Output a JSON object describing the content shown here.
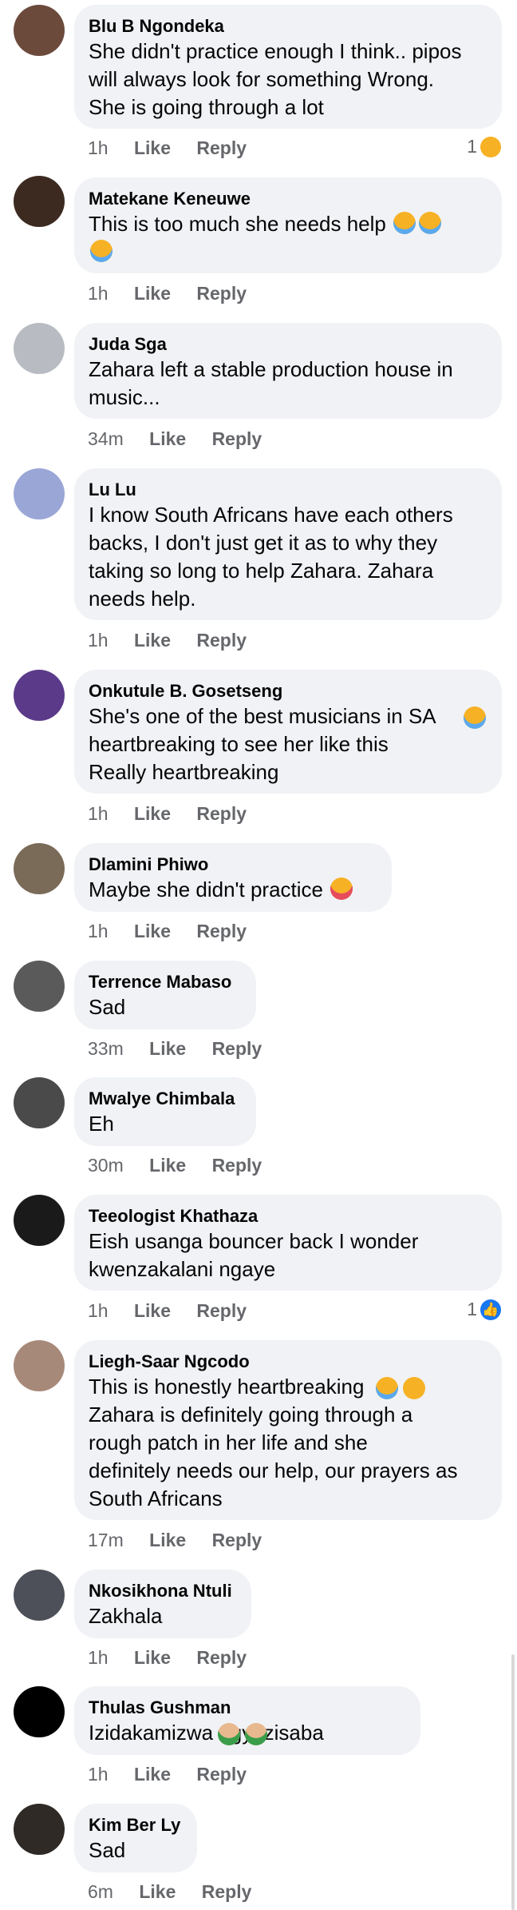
{
  "comments": [
    {
      "author": "Blu B Ngondeka",
      "text": "She didn't practice enough I think.. pipos\nwill always look for something Wrong.\nShe is going through a lot",
      "time": "1h",
      "like": "Like",
      "reply": "Reply",
      "reactions": "1",
      "reaction_icon": "sad",
      "avatar_color": "#6b4a3c"
    },
    {
      "author": "Matekane Keneuwe",
      "text": "This is too much she needs help",
      "time": "1h",
      "like": "Like",
      "reply": "Reply",
      "avatar_color": "#3c2a20"
    },
    {
      "author": "Juda Sga",
      "text": "Zahara left a stable production house in\nmusic...",
      "time": "34m",
      "like": "Like",
      "reply": "Reply",
      "avatar_color": "#b8bcc2"
    },
    {
      "author": "Lu Lu",
      "text": "I know South Africans have each others\nbacks, I don't just get it as to why they\ntaking so long to help Zahara. Zahara\nneeds help.",
      "time": "1h",
      "like": "Like",
      "reply": "Reply",
      "avatar_color": "#9aa6d6"
    },
    {
      "author": "Onkutule B. Gosetseng",
      "text": "She's one of the best musicians in SA\nheartbreaking to see her like this\nReally heartbreaking",
      "time": "1h",
      "like": "Like",
      "reply": "Reply",
      "avatar_color": "#5b3a8a"
    },
    {
      "author": "Dlamini Phiwo",
      "text": "Maybe she didn't practice",
      "time": "1h",
      "like": "Like",
      "reply": "Reply",
      "avatar_color": "#7a6a58"
    },
    {
      "author": "Terrence Mabaso",
      "text": "Sad",
      "time": "33m",
      "like": "Like",
      "reply": "Reply",
      "avatar_color": "#5a5a5a"
    },
    {
      "author": "Mwalye Chimbala",
      "text": "Eh",
      "time": "30m",
      "like": "Like",
      "reply": "Reply",
      "avatar_color": "#4a4a4a"
    },
    {
      "author": "Teeologist Khathaza",
      "text": "Eish usanga bouncer back I wonder\nkwenzakalani ngaye",
      "time": "1h",
      "like": "Like",
      "reply": "Reply",
      "reactions": "1",
      "reaction_icon": "like",
      "avatar_color": "#1a1a1a"
    },
    {
      "author": "Liegh-Saar Ngcodo",
      "text": "This is honestly heartbreaking\nZahara is definitely going through a\nrough patch in her life  and she\ndefinitely needs our help, our prayers as\nSouth Africans",
      "time": "17m",
      "like": "Like",
      "reply": "Reply",
      "avatar_color": "#a7897a"
    },
    {
      "author": "Nkosikhona Ntuli",
      "text": "Zakhala",
      "time": "1h",
      "like": "Like",
      "reply": "Reply",
      "avatar_color": "#4d5058"
    },
    {
      "author": "Thulas Gushman",
      "text": "Izidakamizwa  ngyazisaba",
      "time": "1h",
      "like": "Like",
      "reply": "Reply",
      "avatar_color": "#000000"
    },
    {
      "author": "Kim Ber Ly",
      "text": "Sad",
      "time": "6m",
      "like": "Like",
      "reply": "Reply",
      "avatar_color": "#2f2a25"
    }
  ]
}
